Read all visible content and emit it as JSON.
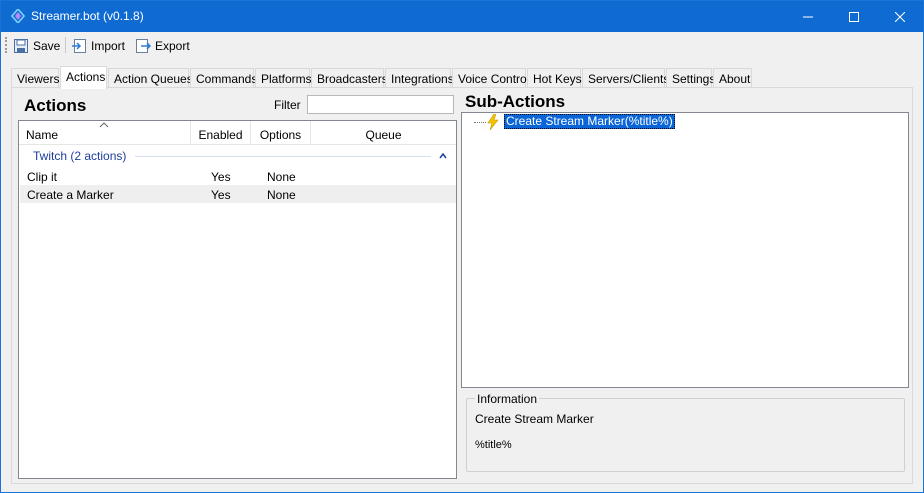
{
  "window": {
    "title": "Streamer.bot (v0.1.8)",
    "controls": {
      "minimize": "—",
      "maximize": "☐",
      "close": "✕"
    }
  },
  "toolbar": {
    "save_label": "Save",
    "import_label": "Import",
    "export_label": "Export"
  },
  "tabs": [
    {
      "label": "Viewers"
    },
    {
      "label": "Actions",
      "active": true
    },
    {
      "label": "Action Queues"
    },
    {
      "label": "Commands"
    },
    {
      "label": "Platforms"
    },
    {
      "label": "Broadcasters"
    },
    {
      "label": "Integrations"
    },
    {
      "label": "Voice Control"
    },
    {
      "label": "Hot Keys"
    },
    {
      "label": "Servers/Clients"
    },
    {
      "label": "Settings"
    },
    {
      "label": "About"
    }
  ],
  "actions": {
    "heading": "Actions",
    "filter_label": "Filter",
    "filter_value": "",
    "columns": {
      "name": "Name",
      "enabled": "Enabled",
      "options": "Options",
      "queue": "Queue"
    },
    "group": {
      "label": "Twitch  (2 actions)"
    },
    "rows": [
      {
        "name": "Clip it",
        "enabled": "Yes",
        "options": "None",
        "queue": ""
      },
      {
        "name": "Create a Marker",
        "enabled": "Yes",
        "options": "None",
        "queue": ""
      }
    ]
  },
  "subactions": {
    "heading": "Sub-Actions",
    "items": [
      {
        "label": "Create Stream Marker(%title%)",
        "icon": "lightning-icon",
        "selected": true
      }
    ]
  },
  "information": {
    "legend": "Information",
    "title": "Create Stream Marker",
    "detail": "%title%"
  },
  "colors": {
    "titlebar": "#0f6bd1",
    "selection": "#0a66d8",
    "group_text": "#1e3f9e"
  }
}
